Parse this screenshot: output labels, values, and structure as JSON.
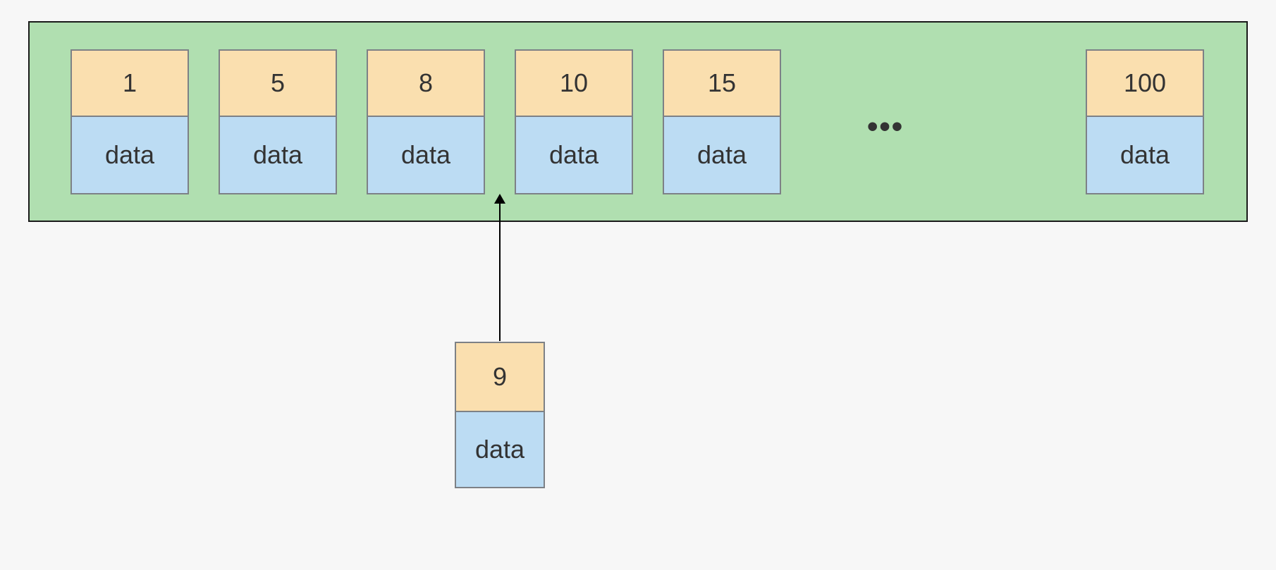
{
  "array": {
    "nodes": [
      {
        "key": "1",
        "data": "data"
      },
      {
        "key": "5",
        "data": "data"
      },
      {
        "key": "8",
        "data": "data"
      },
      {
        "key": "10",
        "data": "data"
      },
      {
        "key": "15",
        "data": "data"
      },
      {
        "key": "100",
        "data": "data"
      }
    ],
    "ellipsis": "•••"
  },
  "insert": {
    "key": "9",
    "data": "data"
  }
}
